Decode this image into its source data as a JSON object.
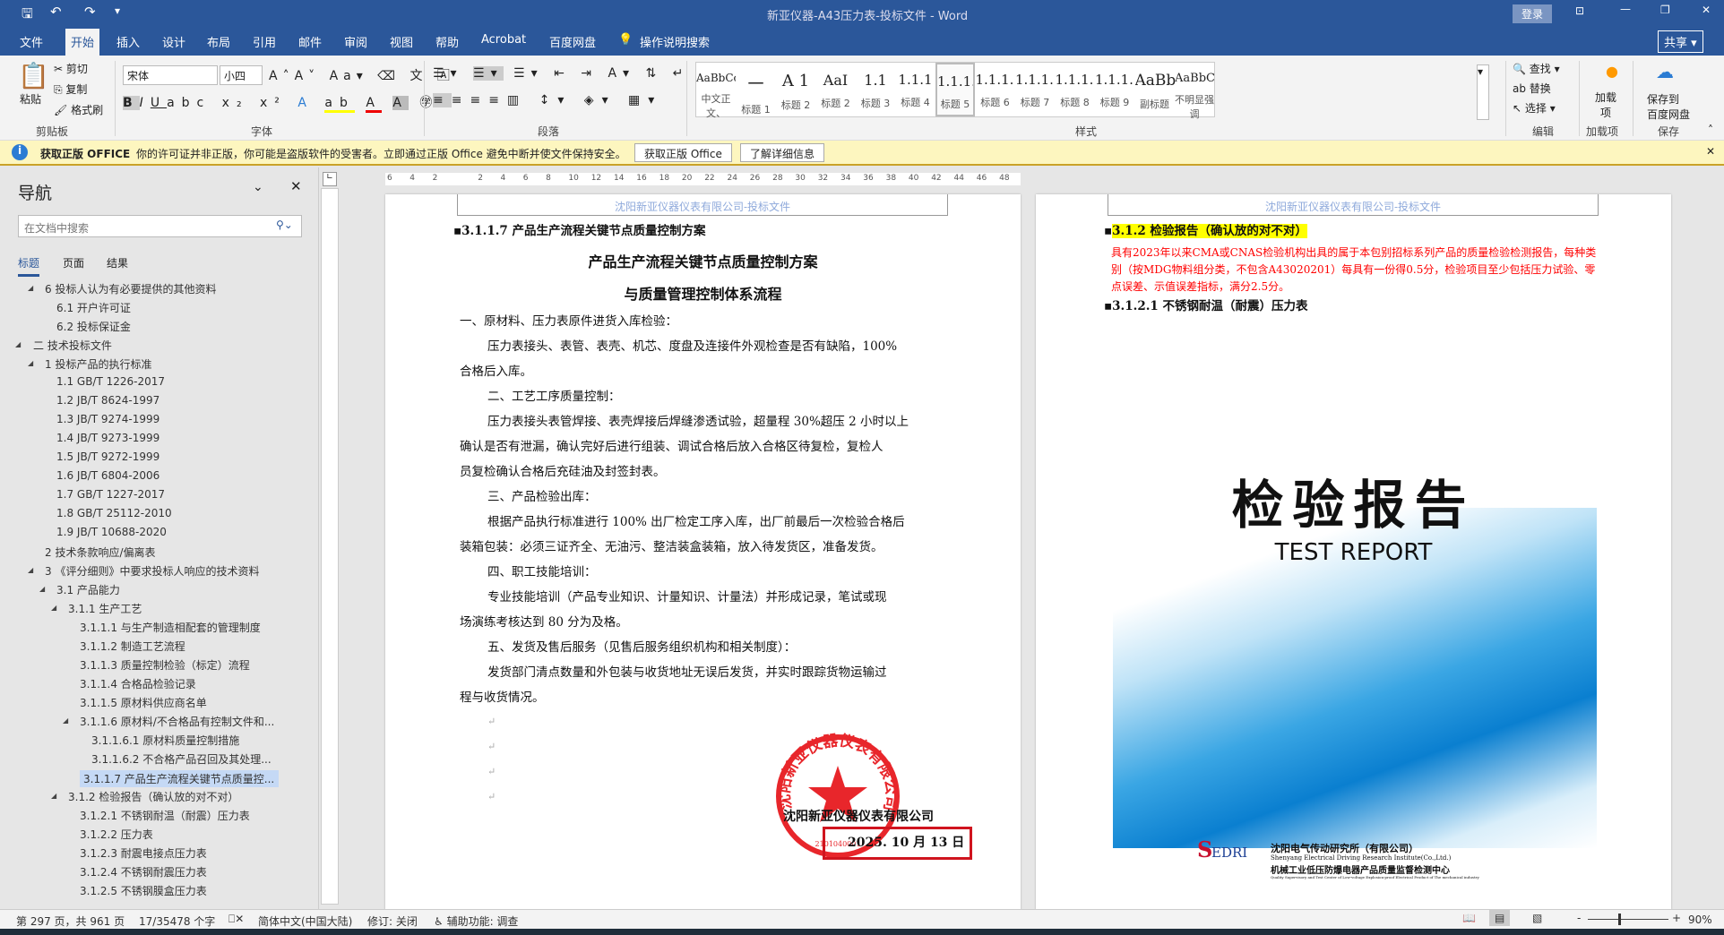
{
  "titlebar": {
    "title": "新亚仪器-A43压力表-投标文件  -  Word",
    "login": "登录",
    "share": "共享"
  },
  "tabs": [
    "文件",
    "开始",
    "插入",
    "设计",
    "布局",
    "引用",
    "邮件",
    "审阅",
    "视图",
    "帮助",
    "Acrobat",
    "百度网盘",
    "操作说明搜索"
  ],
  "ribbon": {
    "clipboard": {
      "paste": "粘贴",
      "cut": "剪切",
      "copy": "复制",
      "format_painter": "格式刷",
      "label": "剪贴板"
    },
    "font": {
      "name": "宋体",
      "size": "小四",
      "label": "字体"
    },
    "paragraph": {
      "label": "段落"
    },
    "styles": {
      "label": "样式",
      "items": [
        {
          "preview": "AaBbCcDdI",
          "name": "中文正文、"
        },
        {
          "preview": "一",
          "name": "标题 1"
        },
        {
          "preview": "A 1",
          "name": "标题 2"
        },
        {
          "preview": "AaI",
          "name": "标题 2"
        },
        {
          "preview": "1.1",
          "name": "标题 3"
        },
        {
          "preview": "1.1.1",
          "name": "标题 4"
        },
        {
          "preview": "1.1.1.1",
          "name": "标题 5"
        },
        {
          "preview": "1.1.1.1",
          "name": "标题 6"
        },
        {
          "preview": "1.1.1.1",
          "name": "标题 7"
        },
        {
          "preview": "1.1.1.1",
          "name": "标题 8"
        },
        {
          "preview": "1.1.1.1",
          "name": "标题 9"
        },
        {
          "preview": "AaBbC",
          "name": "副标题"
        },
        {
          "preview": "AaBbCcD",
          "name": "不明显强调"
        }
      ]
    },
    "editing": {
      "find": "查找",
      "replace": "替换",
      "select": "选择",
      "label": "编辑"
    },
    "addins": {
      "btn": "加载项",
      "label": "加载项"
    },
    "save": {
      "btn1": "保存到",
      "btn2": "百度网盘",
      "label": "保存"
    }
  },
  "infobar": {
    "title": "获取正版 OFFICE",
    "message": "你的许可证并非正版，你可能是盗版软件的受害者。立即通过正版 Office 避免中断并使文件保持安全。",
    "btn_get": "获取正版 Office",
    "btn_more": "了解详细信息"
  },
  "nav": {
    "title": "导航",
    "search_placeholder": "在文档中搜索",
    "tabs": [
      "标题",
      "页面",
      "结果"
    ],
    "items": [
      {
        "t": "6 投标人认为有必要提供的其他资料",
        "l": 2,
        "c": 1
      },
      {
        "t": "6.1 开户许可证",
        "l": 3
      },
      {
        "t": "6.2 投标保证金",
        "l": 3
      },
      {
        "t": "二 技术投标文件",
        "l": 1,
        "c": 1
      },
      {
        "t": "1 投标产品的执行标准",
        "l": 2,
        "c": 1
      },
      {
        "t": "1.1 GB/T 1226-2017",
        "l": 3
      },
      {
        "t": "1.2 JB/T 8624-1997",
        "l": 3
      },
      {
        "t": "1.3 JB/T 9274-1999",
        "l": 3
      },
      {
        "t": "1.4 JB/T 9273-1999",
        "l": 3
      },
      {
        "t": "1.5 JB/T 9272-1999",
        "l": 3
      },
      {
        "t": "1.6 JB/T 6804-2006",
        "l": 3
      },
      {
        "t": "1.7 GB/T 1227-2017",
        "l": 3
      },
      {
        "t": "1.8 GB/T 25112-2010",
        "l": 3
      },
      {
        "t": "1.9 JB/T 10688-2020",
        "l": 3
      },
      {
        "t": "2 技术条款响应/偏离表",
        "l": 2
      },
      {
        "t": "3 《评分细则》中要求投标人响应的技术资料",
        "l": 2,
        "c": 1
      },
      {
        "t": "3.1 产品能力",
        "l": 3,
        "c": 1
      },
      {
        "t": "3.1.1 生产工艺",
        "l": 4,
        "c": 1
      },
      {
        "t": "3.1.1.1 与生产制造相配套的管理制度",
        "l": 5
      },
      {
        "t": "3.1.1.2 制造工艺流程",
        "l": 5
      },
      {
        "t": "3.1.1.3 质量控制检验（标定）流程",
        "l": 5
      },
      {
        "t": "3.1.1.4 合格品检验记录",
        "l": 5
      },
      {
        "t": "3.1.1.5 原材料供应商名单",
        "l": 5
      },
      {
        "t": "3.1.1.6 原材料/不合格品有控制文件和...",
        "l": 5,
        "c": 1
      },
      {
        "t": "3.1.1.6.1 原材料质量控制措施",
        "l": 6
      },
      {
        "t": "3.1.1.6.2 不合格产品召回及其处理...",
        "l": 6
      },
      {
        "t": "3.1.1.7 产品生产流程关键节点质量控...",
        "l": 5,
        "sel": 1
      },
      {
        "t": "3.1.2 检验报告（确认放的对不对）",
        "l": 4,
        "c": 1
      },
      {
        "t": "3.1.2.1 不锈钢耐温（耐震）压力表",
        "l": 5
      },
      {
        "t": "3.1.2.2 压力表",
        "l": 5
      },
      {
        "t": "3.1.2.3 耐震电接点压力表",
        "l": 5
      },
      {
        "t": "3.1.2.4 不锈钢耐震压力表",
        "l": 5
      },
      {
        "t": "3.1.2.5 不锈钢膜盒压力表",
        "l": 5
      }
    ]
  },
  "ruler": [
    "6",
    "4",
    "2",
    "",
    "2",
    "4",
    "6",
    "8",
    "10",
    "12",
    "14",
    "16",
    "18",
    "20",
    "22",
    "24",
    "26",
    "28",
    "30",
    "32",
    "34",
    "36",
    "38",
    "40",
    "42",
    "44",
    "46",
    "48"
  ],
  "page1": {
    "header": "沈阳新亚仪器仪表有限公司-投标文件",
    "heading": "3.1.1.7 产品生产流程关键节点质量控制方案",
    "title1": "产品生产流程关键节点质量控制方案",
    "title2": "与质量管理控制体系流程",
    "lines": [
      {
        "t": "一、原材料、压力表原件进货入库检验：",
        "i": 0
      },
      {
        "t": "压力表接头、表管、表壳、机芯、度盘及连接件外观检查是否有缺陷，100%",
        "i": 1
      },
      {
        "t": "合格后入库。",
        "i": 0
      },
      {
        "t": "二、工艺工序质量控制：",
        "i": 1
      },
      {
        "t": "压力表接头表管焊接、表壳焊接后焊缝渗透试验，超量程 30%超压 2 小时以上",
        "i": 1
      },
      {
        "t": "确认是否有泄漏，确认完好后进行组装、调试合格后放入合格区待复检，复检人",
        "i": 0
      },
      {
        "t": "员复检确认合格后充硅油及封签封表。",
        "i": 0
      },
      {
        "t": "三、产品检验出库：",
        "i": 1
      },
      {
        "t": "根据产品执行标准进行 100% 出厂检定工序入库，出厂前最后一次检验合格后",
        "i": 1
      },
      {
        "t": "装箱包装：必须三证齐全、无油污、整洁装盒装箱，放入待发货区，准备发货。",
        "i": 0
      },
      {
        "t": "四、职工技能培训：",
        "i": 1
      },
      {
        "t": "专业技能培训（产品专业知识、计量知识、计量法）并形成记录，笔试或现",
        "i": 1
      },
      {
        "t": "场演练考核达到 80 分为及格。",
        "i": 0
      },
      {
        "t": "五、发货及售后服务（见售后服务组织机构和相关制度）：",
        "i": 1
      },
      {
        "t": "发货部门清点数量和外包装与收货地址无误后发货，并实时跟踪货物运输过",
        "i": 1
      },
      {
        "t": "程与收货情况。",
        "i": 0
      }
    ],
    "company": "沈阳新亚仪器仪表有限公司",
    "date": "2025. 10 月 13 日",
    "stamp_text": "沈阳新亚仪器仪表有限公司",
    "stamp_code": "2101040001"
  },
  "page2": {
    "header": "沈阳新亚仪器仪表有限公司-投标文件",
    "heading": "3.1.2 检验报告（确认放的对不对）",
    "note": [
      "具有2023年以来CMA或CNAS检验机构出具的属于本包别招标系列产品的质量检验检测报告，每种类",
      "别（按MDG物料组分类，不包含A43020201）每具有一份得0.5分，检验项目至少包括压力试验、零",
      "点误差、示值误差指标，满分2.5分。"
    ],
    "subheading": "3.1.2.1 不锈钢耐温（耐震）压力表",
    "cover": {
      "title_cn": "检验报告",
      "title_en": "TEST REPORT",
      "logo": "EDRI",
      "org_cn": "沈阳电气传动研究所（有限公司）",
      "org_en": "Shenyang Electrical Driving Research Institute(Co.,Ltd.)",
      "center_cn": "机械工业低压防爆电器产品质量监督检测中心",
      "center_en": "Quality Supervisory and Test Center of Low-voltage Explosion-proof Electrical Product of The mechanical industry"
    }
  },
  "status": {
    "page": "第 297 页，共 961 页",
    "words": "17/35478 个字",
    "lang": "简体中文(中国大陆)",
    "track": "修订: 关闭",
    "access": "辅助功能: 调查",
    "zoom": "90%"
  },
  "colors": {
    "brand": "#2b579a",
    "stamp": "#e8262b",
    "note": "#ff0000",
    "highlight": "#ffff00"
  }
}
